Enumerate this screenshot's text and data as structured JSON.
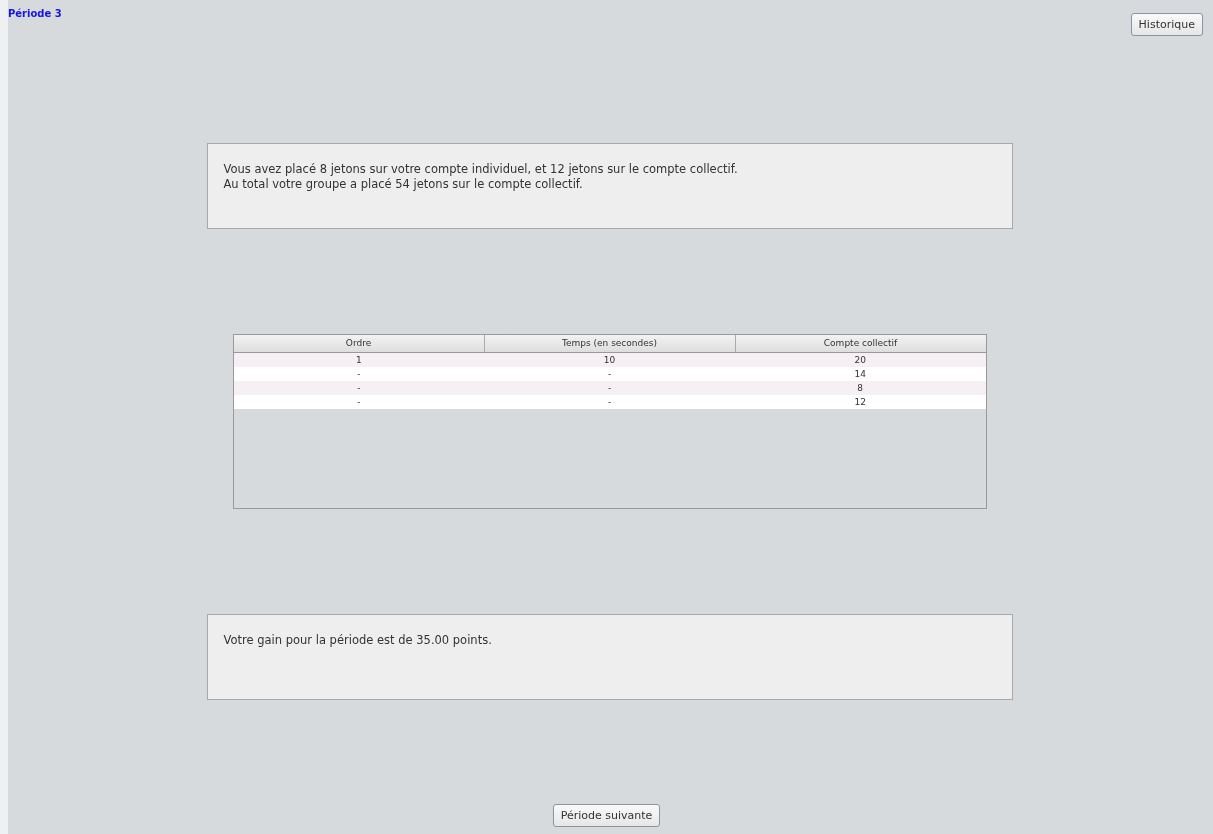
{
  "period_title": "Période 3",
  "history_button": "Historique",
  "summary_lines": [
    "Vous avez placé 8 jetons sur votre compte individuel, et 12 jetons sur le compte collectif.",
    "Au total votre groupe a placé 54 jetons sur le compte collectif."
  ],
  "table": {
    "columns": [
      "Ordre",
      "Temps (en secondes)",
      "Compte collectif"
    ],
    "rows": [
      [
        "1",
        "10",
        "20"
      ],
      [
        "-",
        "-",
        "14"
      ],
      [
        "-",
        "-",
        "8"
      ],
      [
        "-",
        "-",
        "12"
      ]
    ]
  },
  "gain_text": "Votre gain pour la période est de 35.00 points.",
  "next_button": "Période suivante"
}
